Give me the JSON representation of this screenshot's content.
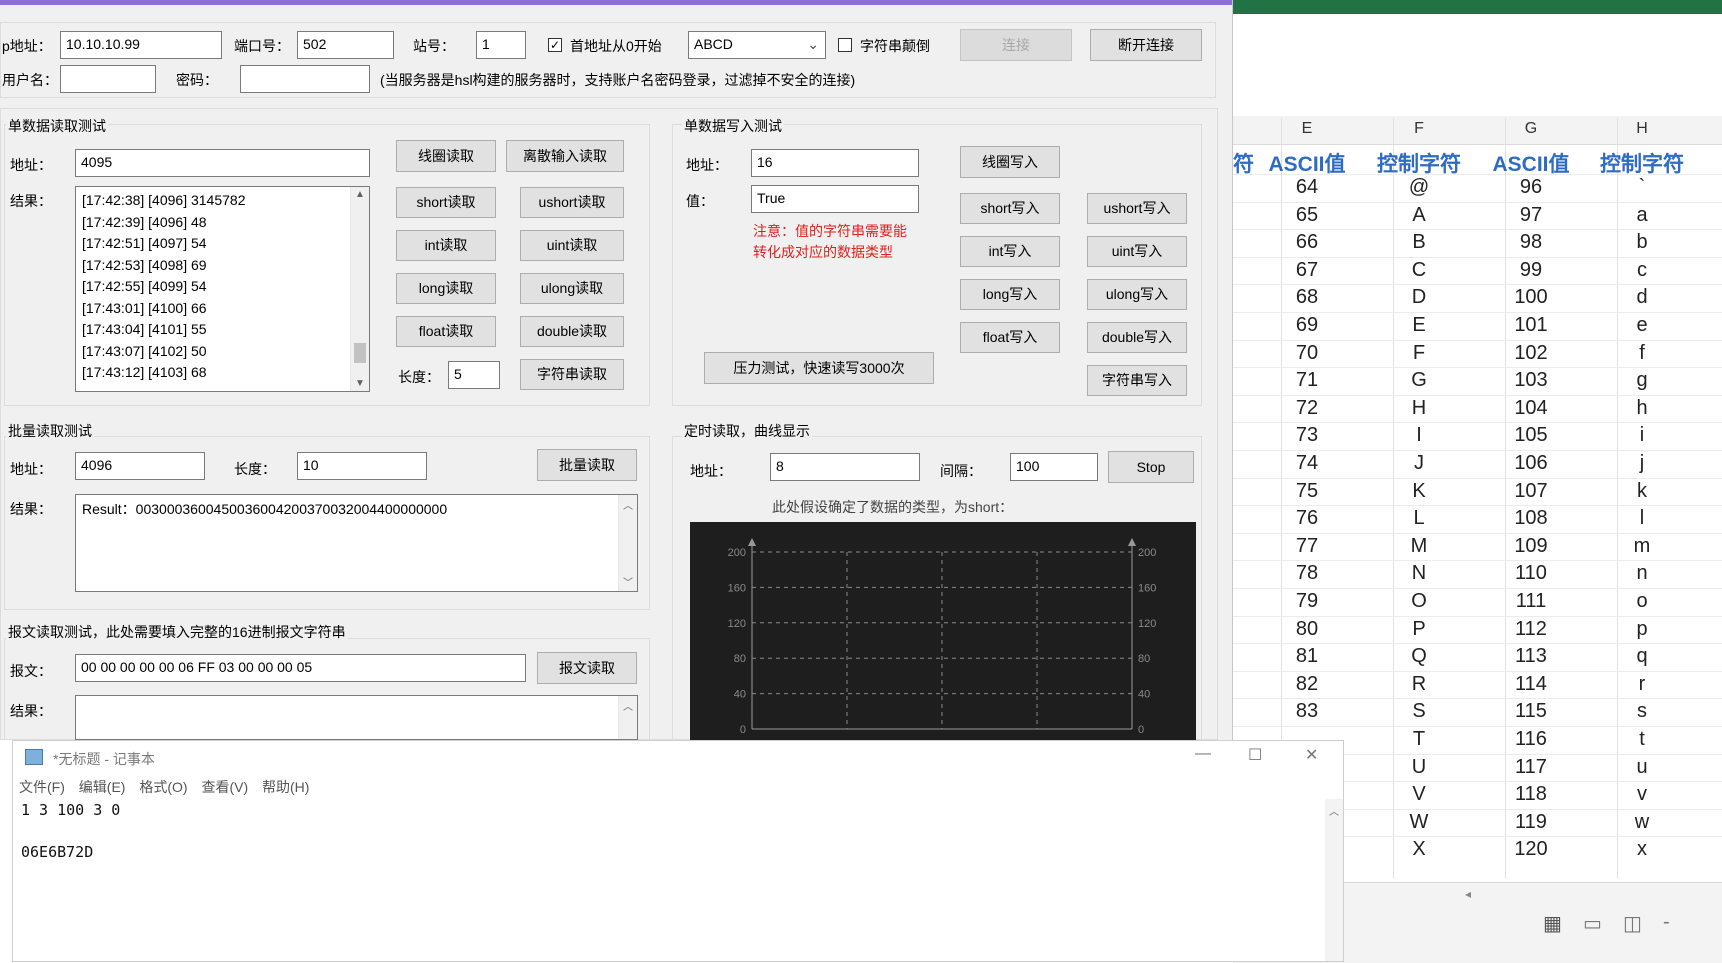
{
  "conn": {
    "ip_label": "p地址：",
    "ip_value": "10.10.10.99",
    "port_label": "端口号：",
    "port_value": "502",
    "station_label": "站号：",
    "station_value": "1",
    "first_addr_zero": "首地址从0开始",
    "byte_order": "ABCD",
    "string_reverse": "字符串颠倒",
    "connect_btn": "连接",
    "disconnect_btn": "断开连接",
    "user_label": "用户名：",
    "user_value": "",
    "pwd_label": "密码：",
    "pwd_value": "",
    "note": "(当服务器是hsl构建的服务器时，支持账户名密码登录，过滤掉不安全的连接)"
  },
  "read": {
    "title": "单数据读取测试",
    "addr_label": "地址：",
    "addr_value": "4095",
    "result_label": "结果：",
    "results": [
      "[17:42:38] [4096] 3145782",
      "[17:42:39] [4096] 48",
      "[17:42:51] [4097] 54",
      "[17:42:53] [4098] 69",
      "[17:42:55] [4099] 54",
      "[17:43:01] [4100] 66",
      "[17:43:04] [4101] 55",
      "[17:43:07] [4102] 50",
      "[17:43:12] [4103] 68"
    ],
    "buttons": {
      "coil": "线圈读取",
      "discrete": "离散输入读取",
      "short": "short读取",
      "ushort": "ushort读取",
      "int": "int读取",
      "uint": "uint读取",
      "long": "long读取",
      "ulong": "ulong读取",
      "float": "float读取",
      "double": "double读取",
      "string": "字符串读取"
    },
    "len_label": "长度：",
    "len_value": "5"
  },
  "write": {
    "title": "单数据写入测试",
    "addr_label": "地址：",
    "addr_value": "16",
    "value_label": "值：",
    "value_value": "True",
    "note_line1": "注意：值的字符串需要能",
    "note_line2": "转化成对应的数据类型",
    "buttons": {
      "coil": "线圈写入",
      "short": "short写入",
      "ushort": "ushort写入",
      "int": "int写入",
      "uint": "uint写入",
      "long": "long写入",
      "ulong": "ulong写入",
      "float": "float写入",
      "double": "double写入",
      "string": "字符串写入",
      "stress": "压力测试，快速读写3000次"
    }
  },
  "batch": {
    "title": "批量读取测试",
    "addr_label": "地址：",
    "addr_value": "4096",
    "len_label": "长度：",
    "len_value": "10",
    "read_btn": "批量读取",
    "result_label": "结果：",
    "result_value": "Result：0030003600450036004200370032004400000000"
  },
  "message": {
    "title": "报文读取测试，此处需要填入完整的16进制报文字符串",
    "label": "报文：",
    "value": "00 00 00 00 00 06 FF 03 00 00 00 05",
    "read_btn": "报文读取",
    "result_label": "结果："
  },
  "timer": {
    "title": "定时读取，曲线显示",
    "addr_label": "地址：",
    "addr_value": "8",
    "interval_label": "间隔：",
    "interval_value": "100",
    "stop_btn": "Stop",
    "note": "此处假设确定了数据的类型，为short："
  },
  "chart_data": {
    "type": "line",
    "title": "",
    "xlabel": "",
    "ylabel": "",
    "ylim": [
      0,
      200
    ],
    "yticks": [
      "200",
      "160",
      "120",
      "80",
      "40",
      "0"
    ],
    "grid": true,
    "series": []
  },
  "excel": {
    "columns": [
      "E",
      "F",
      "G",
      "H"
    ],
    "headers": [
      "ASCII值",
      "控制字符",
      "ASCII值",
      "控制字符"
    ],
    "partial_left_header": "符",
    "rows": [
      [
        "64",
        "@",
        "96",
        "`"
      ],
      [
        "65",
        "A",
        "97",
        "a"
      ],
      [
        "66",
        "B",
        "98",
        "b"
      ],
      [
        "67",
        "C",
        "99",
        "c"
      ],
      [
        "68",
        "D",
        "100",
        "d"
      ],
      [
        "69",
        "E",
        "101",
        "e"
      ],
      [
        "70",
        "F",
        "102",
        "f"
      ],
      [
        "71",
        "G",
        "103",
        "g"
      ],
      [
        "72",
        "H",
        "104",
        "h"
      ],
      [
        "73",
        "I",
        "105",
        "i"
      ],
      [
        "74",
        "J",
        "106",
        "j"
      ],
      [
        "75",
        "K",
        "107",
        "k"
      ],
      [
        "76",
        "L",
        "108",
        "l"
      ],
      [
        "77",
        "M",
        "109",
        "m"
      ],
      [
        "78",
        "N",
        "110",
        "n"
      ],
      [
        "79",
        "O",
        "111",
        "o"
      ],
      [
        "80",
        "P",
        "112",
        "p"
      ],
      [
        "81",
        "Q",
        "113",
        "q"
      ],
      [
        "82",
        "R",
        "114",
        "r"
      ],
      [
        "83",
        "S",
        "115",
        "s"
      ],
      [
        "",
        "T",
        "116",
        "t"
      ],
      [
        "",
        "U",
        "117",
        "u"
      ],
      [
        "",
        "V",
        "118",
        "v"
      ],
      [
        "",
        "W",
        "119",
        "w"
      ],
      [
        "",
        "X",
        "120",
        "x"
      ]
    ]
  },
  "notepad": {
    "title": "*无标题 - 记事本",
    "menu": [
      "文件(F)",
      "编辑(E)",
      "格式(O)",
      "查看(V)",
      "帮助(H)"
    ],
    "line1": "1 3 100 3 0",
    "line2": "06E6B72D"
  }
}
